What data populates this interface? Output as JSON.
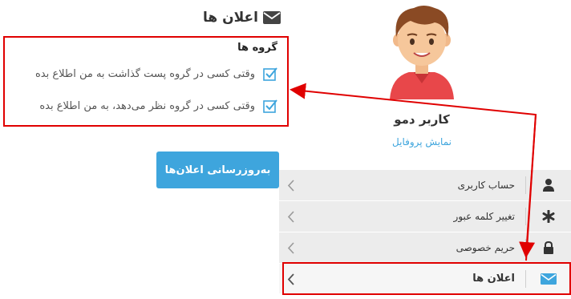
{
  "notifications": {
    "title": "اعلان ها",
    "icon": "envelope-icon",
    "groups_title": "گروه ها",
    "options": [
      {
        "label": "وقتی کسی در گروه پست گذاشت به من اطلاع بده",
        "checked": true
      },
      {
        "label": "وقتی کسی در گروه نظر می‌دهد، به من اطلاع بده",
        "checked": true
      }
    ],
    "update_button": "به‌روزرسانی اعلان‌ها"
  },
  "profile": {
    "name": "کاربر دمو",
    "view_profile": "نمایش پروفایل"
  },
  "menu": {
    "items": [
      {
        "label": "حساب کاربری",
        "icon": "user-icon"
      },
      {
        "label": "تغییر کلمه عبور",
        "icon": "asterisk-icon"
      },
      {
        "label": "حریم خصوصی",
        "icon": "lock-icon"
      },
      {
        "label": "اعلان ها",
        "icon": "envelope-icon",
        "active": true
      }
    ]
  },
  "colors": {
    "accent": "#3ea5dd",
    "highlight": "#e00000",
    "menu_bg": "#ececec"
  }
}
